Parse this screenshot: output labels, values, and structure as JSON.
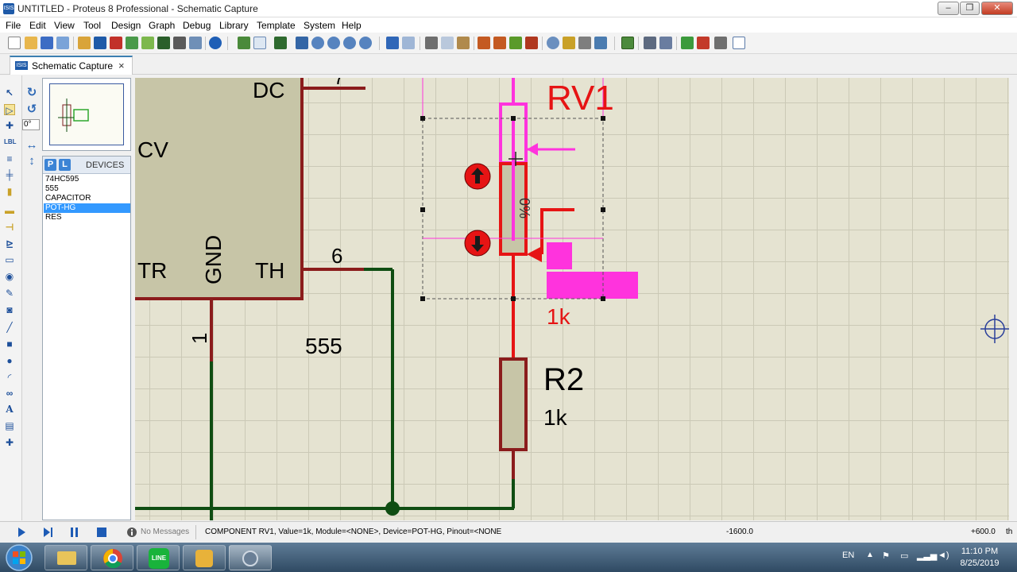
{
  "window": {
    "title": "UNTITLED - Proteus 8 Professional - Schematic Capture"
  },
  "menu": [
    "File",
    "Edit",
    "View",
    "Tool",
    "Design",
    "Graph",
    "Debug",
    "Library",
    "Template",
    "System",
    "Help"
  ],
  "tab": {
    "label": "Schematic Capture",
    "close": "×"
  },
  "rotation": {
    "angle_value": "0°"
  },
  "devices": {
    "mode_p": "P",
    "mode_l": "L",
    "header": "DEVICES",
    "items": [
      "74HC595",
      "555",
      "CAPACITOR",
      "POT-HG",
      "RES"
    ],
    "selected": "POT-HG"
  },
  "schematic": {
    "ic": {
      "name": "555",
      "pins": {
        "dc": "DC",
        "cv": "CV",
        "tr": "TR",
        "gnd": "GND",
        "th": "TH"
      },
      "pin_numbers": {
        "top": "7",
        "th": "6",
        "gnd": "1"
      }
    },
    "rv1": {
      "ref": "RV1",
      "value": "1k",
      "percent": "0%"
    },
    "r2": {
      "ref": "R2",
      "value": "1k"
    }
  },
  "status": {
    "messages": "No Messages",
    "info": "COMPONENT RV1, Value=1k, Module=<NONE>, Device=POT-HG, Pinout=<NONE",
    "x_coord": "-1600.0",
    "y_coord": "+600.0",
    "units": "th"
  },
  "taskbar": {
    "lang": "EN",
    "time": "11:10 PM",
    "date": "8/25/2019"
  },
  "colors": {
    "wire_dark_red": "#8b1c1c",
    "wire_green": "#0f4d12",
    "selection_magenta": "#ff33dd",
    "highlight_red": "#e61414",
    "component_fill": "#c7c5a7",
    "canvas_bg": "#e5e3d1"
  }
}
